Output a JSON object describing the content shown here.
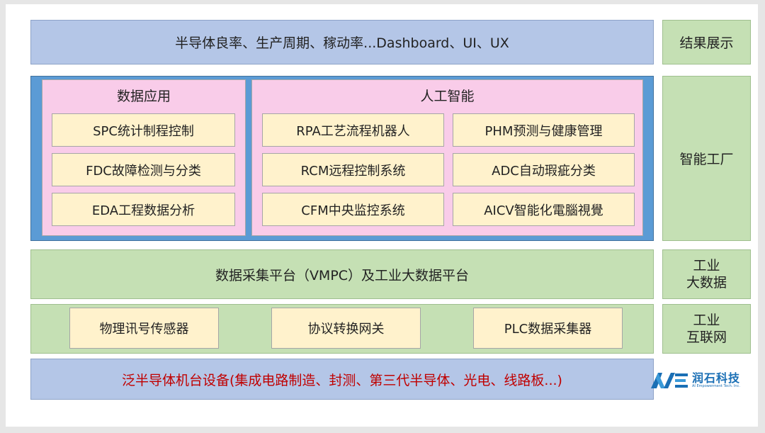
{
  "layers": {
    "top": "半导体良率、生产周期、稼动率...Dashboard、UI、UX",
    "data_app": {
      "title": "数据应用",
      "items": [
        "SPC统计制程控制",
        "FDC故障检测与分类",
        "EDA工程数据分析"
      ]
    },
    "ai": {
      "title": "人工智能",
      "left": [
        "RPA工艺流程机器人",
        "RCM远程控制系统",
        "CFM中央监控系统"
      ],
      "right": [
        "PHM预测与健康管理",
        "ADC自动瑕疵分类",
        "AICV智能化電腦視覺"
      ]
    },
    "platform": "数据采集平台（VMPC）及工业大数据平台",
    "iot": [
      "物理讯号传感器",
      "协议转换网关",
      "PLC数据采集器"
    ],
    "equipment": "泛半导体机台设备(集成电路制造、封测、第三代半导体、光电、线路板...)"
  },
  "side_labels": {
    "result": "结果展示",
    "factory": "智能工厂",
    "bigdata_l1": "工业",
    "bigdata_l2": "大数据",
    "iiot_l1": "工业",
    "iiot_l2": "互联网"
  },
  "logo": {
    "name": "润石科技",
    "tagline": "AI Empowerment Tech. Inc."
  },
  "colors": {
    "blue": "#b4c6e7",
    "green": "#c5e0b4",
    "yellow": "#fff2cc",
    "pink": "#f9cce9",
    "frame": "#5b9bd5",
    "equipment_text": "#c00000",
    "logo": "#1a6fb5"
  }
}
